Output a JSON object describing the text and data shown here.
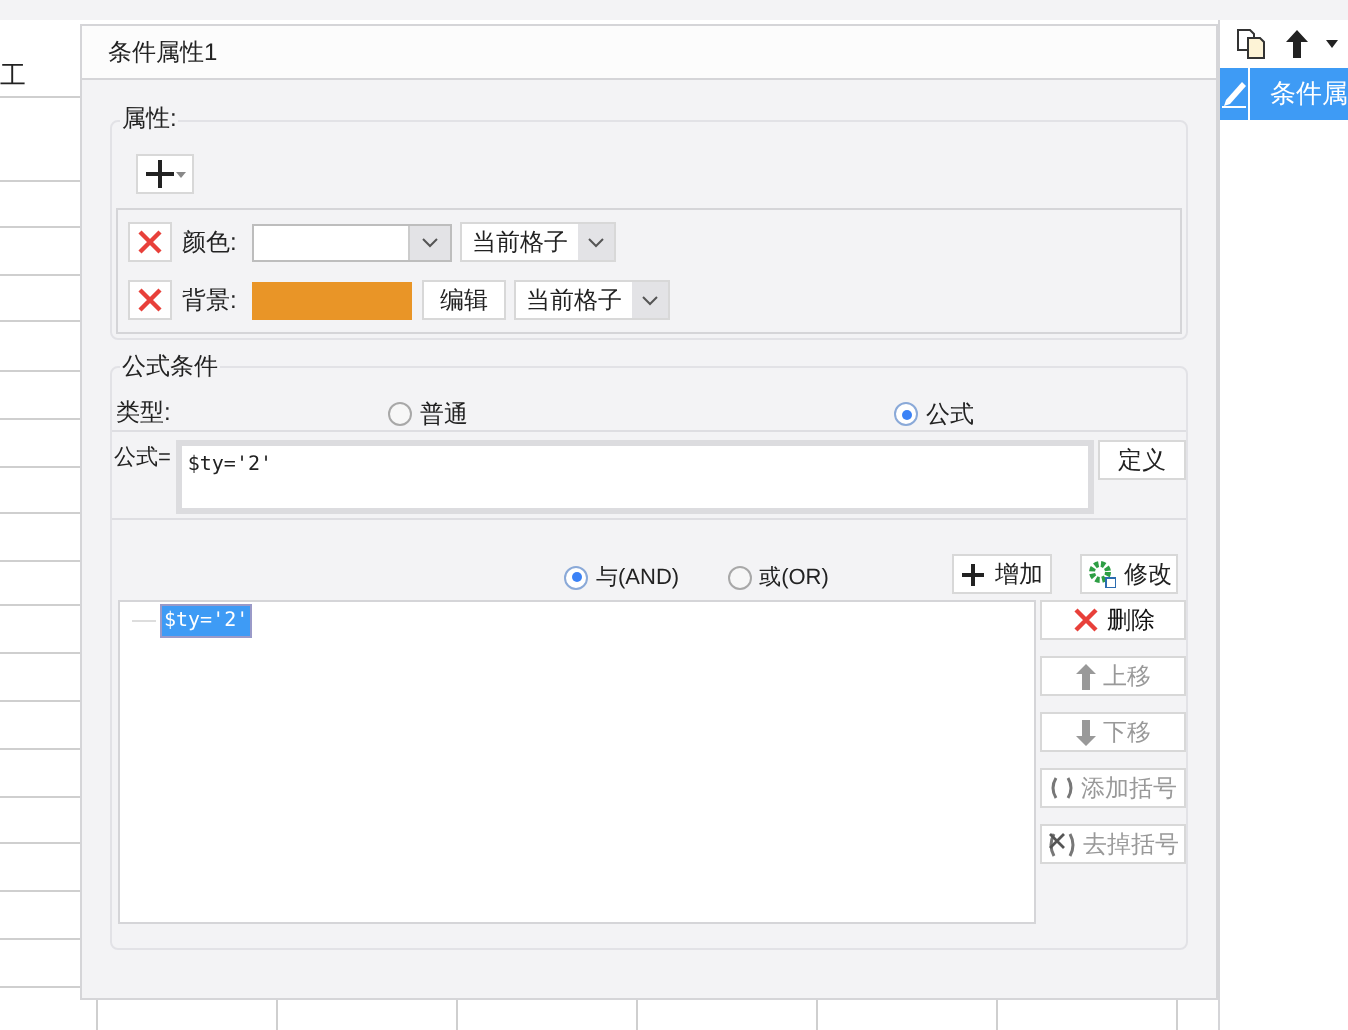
{
  "sheet": {
    "cell_text": "工"
  },
  "dialog": {
    "title": "条件属性1",
    "attributes": {
      "legend": "属性:",
      "rows": [
        {
          "kind": "color",
          "label": "颜色:",
          "color": "#ffffff",
          "scope": "当前格子"
        },
        {
          "kind": "background",
          "label": "背景:",
          "color": "#e99527",
          "edit_button": "编辑",
          "scope": "当前格子"
        }
      ]
    },
    "formula": {
      "legend": "公式条件",
      "type_label": "类型:",
      "types": [
        {
          "label": "普通",
          "selected": false
        },
        {
          "label": "公式",
          "selected": true
        }
      ],
      "formula_label": "公式=",
      "formula_value": "$ty='2'",
      "define_button": "定义",
      "logic": [
        {
          "label": "与(AND)",
          "selected": true
        },
        {
          "label": "或(OR)",
          "selected": false
        }
      ],
      "add_button": "增加",
      "modify_button": "修改",
      "conditions": [
        {
          "text": "$ty='2'",
          "selected": true
        }
      ],
      "actions": [
        {
          "kind": "delete",
          "label": "删除",
          "disabled": false
        },
        {
          "kind": "up",
          "label": "上移",
          "disabled": true
        },
        {
          "kind": "down",
          "label": "下移",
          "disabled": true
        },
        {
          "kind": "add-bracket",
          "label": "添加括号",
          "disabled": true
        },
        {
          "kind": "remove-bracket",
          "label": "去掉括号",
          "disabled": true
        }
      ]
    }
  },
  "side_panel": {
    "items": [
      {
        "text": "条件属",
        "selected": true
      }
    ]
  }
}
